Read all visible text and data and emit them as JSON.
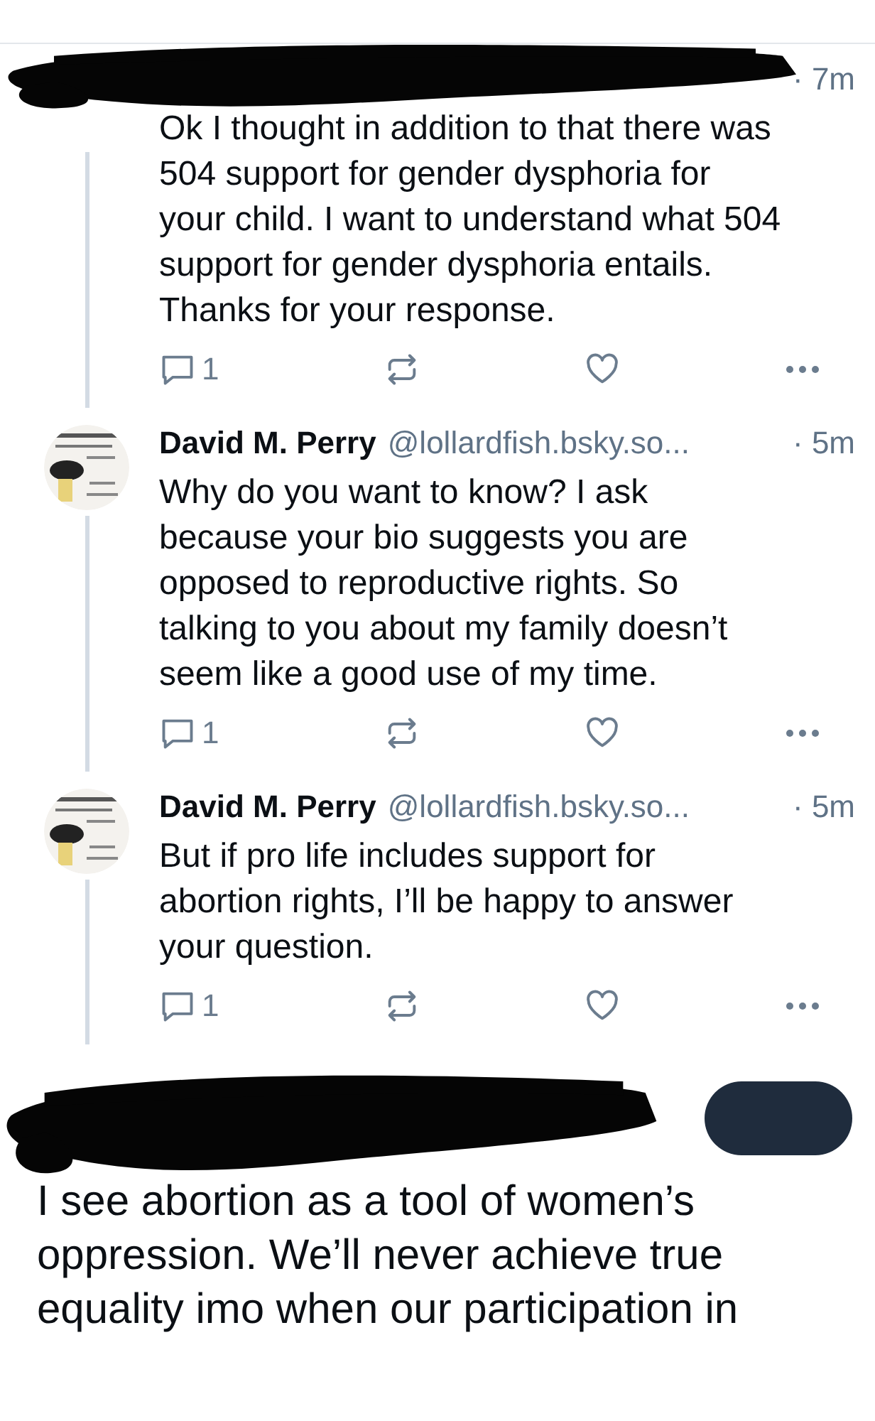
{
  "thread": [
    {
      "kind": "reply",
      "redacted": true,
      "time": "· 7m",
      "text": "Ok I thought in addition to that there was 504 support for gender dysphoria for your child. I want to understand what 504 support for gender dysphoria entails. Thanks for your response.",
      "reply_count": "1"
    },
    {
      "kind": "reply",
      "redacted": false,
      "name": "David M. Perry",
      "handle": "@lollardfish.bsky.so...",
      "time": "· 5m",
      "text": "Why do you want to know? I ask because your bio suggests you are opposed to reproductive rights. So talking to you about my family doesn’t seem like a good use of my time.",
      "reply_count": "1"
    },
    {
      "kind": "reply",
      "redacted": false,
      "name": "David M. Perry",
      "handle": "@lollardfish.bsky.so...",
      "time": "· 5m",
      "text": "But if pro life includes support for abortion rights, I’ll be happy to answer your question.",
      "reply_count": "1"
    }
  ],
  "main_post": {
    "redacted": true,
    "text": "I see abortion as a tool of women’s oppression. We’ll never achieve true equality imo when our participation in"
  }
}
